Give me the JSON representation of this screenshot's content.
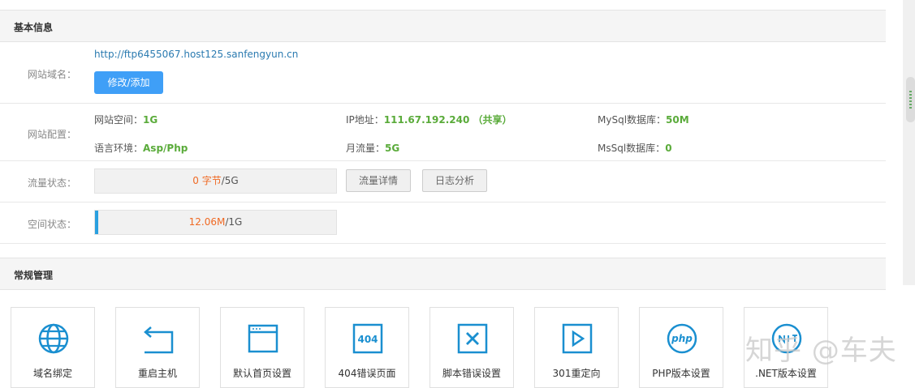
{
  "basic": {
    "title": "基本信息",
    "domain": {
      "label": "网站域名：",
      "url": "http://ftp6455067.host125.sanfengyun.cn",
      "edit_button": "修改/添加"
    },
    "config": {
      "label": "网站配置：",
      "items": [
        {
          "key": "网站空间：",
          "value": "1G"
        },
        {
          "key": "IP地址：",
          "value": "111.67.192.240 （共享）"
        },
        {
          "key": "MySql数据库：",
          "value": "50M"
        },
        {
          "key": "语言环境：",
          "value": "Asp/Php"
        },
        {
          "key": "月流量：",
          "value": "5G"
        },
        {
          "key": "MsSql数据库：",
          "value": "0"
        }
      ]
    },
    "traffic": {
      "label": "流量状态：",
      "used": "0 字节",
      "total": "/5G",
      "usage_fraction": 0,
      "detail_button": "流量详情",
      "log_button": "日志分析"
    },
    "space": {
      "label": "空间状态：",
      "used": "12.06M",
      "total": "/1G",
      "usage_fraction": 0.0118
    }
  },
  "management": {
    "title": "常规管理",
    "tiles": [
      {
        "label": "域名绑定",
        "icon": "globe-icon"
      },
      {
        "label": "重启主机",
        "icon": "restart-icon"
      },
      {
        "label": "默认首页设置",
        "icon": "browser-window-icon"
      },
      {
        "label": "404错误页面",
        "icon": "404-icon"
      },
      {
        "label": "脚本错误设置",
        "icon": "close-box-icon"
      },
      {
        "label": "301重定向",
        "icon": "play-box-icon"
      },
      {
        "label": "PHP版本设置",
        "icon": "php-icon"
      },
      {
        "label": ".NET版本设置",
        "icon": "net-icon"
      }
    ]
  },
  "colors": {
    "accent_blue": "#3f9ff7",
    "link": "#2a7ab0",
    "value_green": "#5aab3a",
    "used_orange": "#f06a24",
    "icon_blue": "#1a8fd0"
  },
  "watermark": "知乎 @车夫"
}
